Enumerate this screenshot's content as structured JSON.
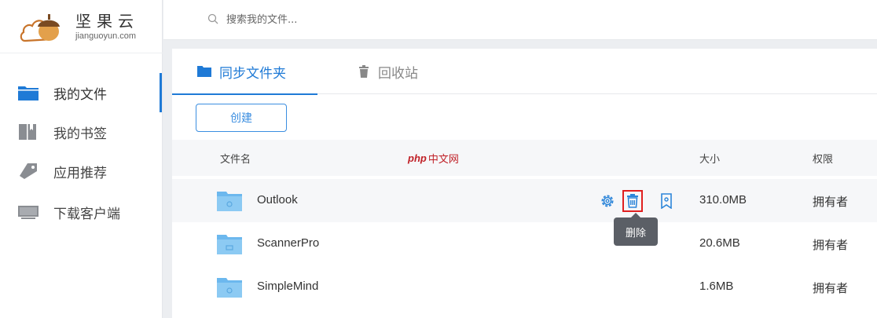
{
  "brand": {
    "name_cn": "坚果云",
    "domain": "jianguoyun.com"
  },
  "search": {
    "placeholder": "搜索我的文件..."
  },
  "sidebar": {
    "items": [
      {
        "label": "我的文件",
        "icon": "folder-icon",
        "active": true
      },
      {
        "label": "我的书签",
        "icon": "bookmark-book-icon",
        "active": false
      },
      {
        "label": "应用推荐",
        "icon": "tag-icon",
        "active": false
      },
      {
        "label": "下载客户端",
        "icon": "monitor-icon",
        "active": false
      }
    ]
  },
  "tabs": [
    {
      "label": "同步文件夹",
      "icon": "folder-icon",
      "active": true
    },
    {
      "label": "回收站",
      "icon": "trash-icon",
      "active": false
    }
  ],
  "toolbar": {
    "create_label": "创建"
  },
  "table": {
    "headers": {
      "name": "文件名",
      "size": "大小",
      "permission": "权限"
    },
    "rows": [
      {
        "name": "Outlook",
        "size": "310.0MB",
        "permission": "拥有者"
      },
      {
        "name": "ScannerPro",
        "size": "20.6MB",
        "permission": "拥有者"
      },
      {
        "name": "SimpleMind",
        "size": "1.6MB",
        "permission": "拥有者"
      }
    ]
  },
  "tooltip": {
    "text": "删除"
  },
  "watermark": {
    "php": "php",
    "cn": "中文网"
  },
  "colors": {
    "accent": "#1f7ad6",
    "folder": "#6cb8ee",
    "highlight_border": "#e02020",
    "tooltip_bg": "#5b5f66"
  }
}
